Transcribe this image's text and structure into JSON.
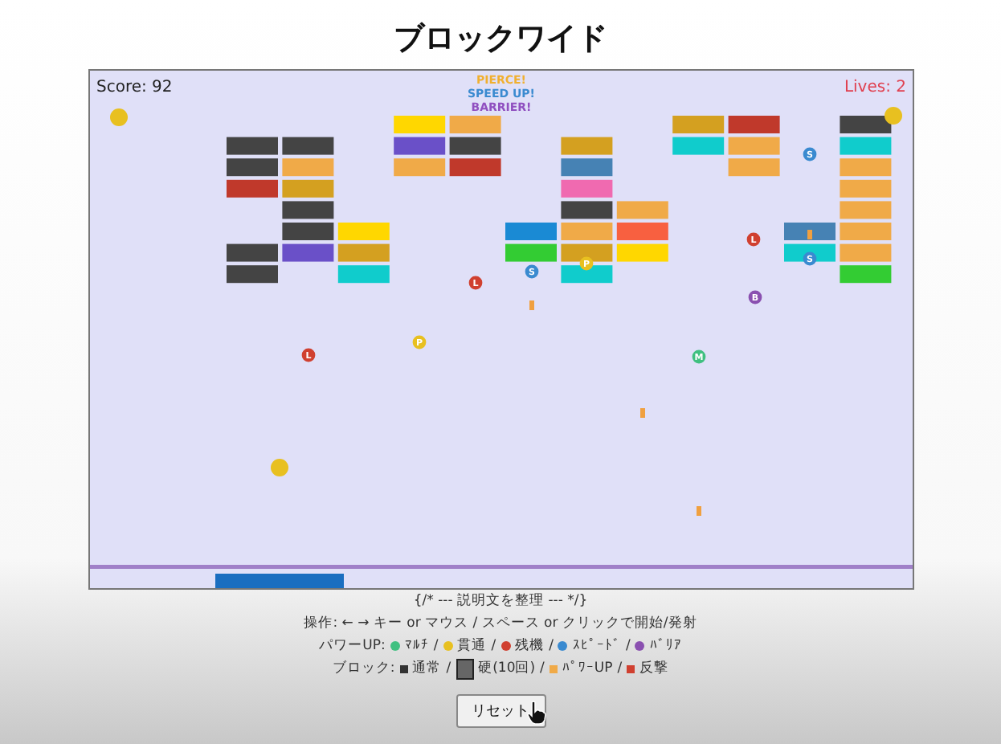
{
  "title": "ブロックワイド",
  "game": {
    "score": "Score: 92",
    "lives": "Lives: 2",
    "messages": [
      {
        "text": "PIERCE!",
        "color": "#f0b030"
      },
      {
        "text": "SPEED UP!",
        "color": "#3a8ad0"
      },
      {
        "text": "BARRIER!",
        "color": "#9050c0"
      }
    ],
    "bricks": [
      {
        "color": "#444444"
      },
      {
        "color": "#444444"
      },
      {
        "color": "#c0392b"
      },
      {
        "color": "#444444"
      },
      {
        "color": "#444444"
      },
      {
        "color": "#444444"
      },
      {
        "color": "#f0aa48"
      },
      {
        "color": "#d4a020"
      },
      {
        "color": "#444444"
      },
      {
        "color": "#444444"
      },
      {
        "color": "#6a50c8"
      },
      {
        "color": "#ffd700"
      },
      {
        "color": "#d4a020"
      },
      {
        "color": "#10cccc"
      },
      {
        "color": "#ffd700"
      },
      {
        "color": "#6a50c8"
      },
      {
        "color": "#f0aa48"
      },
      {
        "color": "#f0aa48"
      },
      {
        "color": "#444444"
      },
      {
        "color": "#c0392b"
      },
      {
        "color": "#1a8ad4"
      },
      {
        "color": "#33cc33"
      },
      {
        "color": "#d4a020"
      },
      {
        "color": "#4682b4"
      },
      {
        "color": "#f06ab0"
      },
      {
        "color": "#444444"
      },
      {
        "color": "#f0aa48"
      },
      {
        "color": "#d4a020"
      },
      {
        "color": "#10cccc"
      },
      {
        "color": "#f0aa48"
      },
      {
        "color": "#f86040"
      },
      {
        "color": "#ffd700"
      },
      {
        "color": "#d4a020"
      },
      {
        "color": "#10cccc"
      },
      {
        "color": "#c0392b"
      },
      {
        "color": "#f0aa48"
      },
      {
        "color": "#f0aa48"
      },
      {
        "color": "#4682b4"
      },
      {
        "color": "#10cccc"
      },
      {
        "color": "#444444"
      },
      {
        "color": "#10cccc"
      },
      {
        "color": "#f0aa48"
      },
      {
        "color": "#f0aa48"
      },
      {
        "color": "#f0aa48"
      },
      {
        "color": "#f0aa48"
      },
      {
        "color": "#f0aa48"
      },
      {
        "color": "#33cc33"
      }
    ],
    "powerups": [
      {
        "letter": "S",
        "color": "#3a8ad0"
      },
      {
        "letter": "L",
        "color": "#d04030"
      },
      {
        "letter": "S",
        "color": "#3a8ad0"
      },
      {
        "letter": "P",
        "color": "#e8c020"
      },
      {
        "letter": "S",
        "color": "#3a8ad0"
      },
      {
        "letter": "L",
        "color": "#d04030"
      },
      {
        "letter": "B",
        "color": "#8a50b0"
      },
      {
        "letter": "P",
        "color": "#e8c020"
      },
      {
        "letter": "L",
        "color": "#d04030"
      },
      {
        "letter": "M",
        "color": "#40c080"
      }
    ]
  },
  "comment": "{/* --- 説明文を整理 --- */}",
  "controls": "操作: ← → キー or マウス / スペース or クリックで開始/発射",
  "powerup_legend": {
    "label": "パワーUP:",
    "items": [
      {
        "text": "ﾏﾙﾁ",
        "color": "#40c080"
      },
      {
        "text": "/",
        "kind": "separator"
      },
      {
        "text": "貫通",
        "color": "#e8c020"
      },
      {
        "text": "/",
        "kind": "separator"
      },
      {
        "text": "残機",
        "color": "#d04030"
      },
      {
        "text": "/",
        "kind": "separator"
      },
      {
        "text": "ｽﾋﾟｰﾄﾞ",
        "color": "#3a8ad0"
      },
      {
        "text": "/",
        "kind": "separator"
      },
      {
        "text": "ﾊﾞﾘｱ",
        "color": "#8a50b0"
      }
    ]
  },
  "block_legend": {
    "label": "ブロック:",
    "items": [
      {
        "text": "通常",
        "color": "#333333",
        "kind": "normal"
      },
      {
        "text": "/",
        "kind": "separator"
      },
      {
        "text": "硬(10回)",
        "color": "#666666",
        "kind": "hard"
      },
      {
        "text": "/",
        "kind": "separator"
      },
      {
        "text": "ﾊﾟﾜｰUP",
        "color": "#f0aa48",
        "kind": "normal"
      },
      {
        "text": "/",
        "kind": "separator"
      },
      {
        "text": "反撃",
        "color": "#d04030",
        "kind": "normal"
      }
    ]
  },
  "reset_button": "リセット"
}
